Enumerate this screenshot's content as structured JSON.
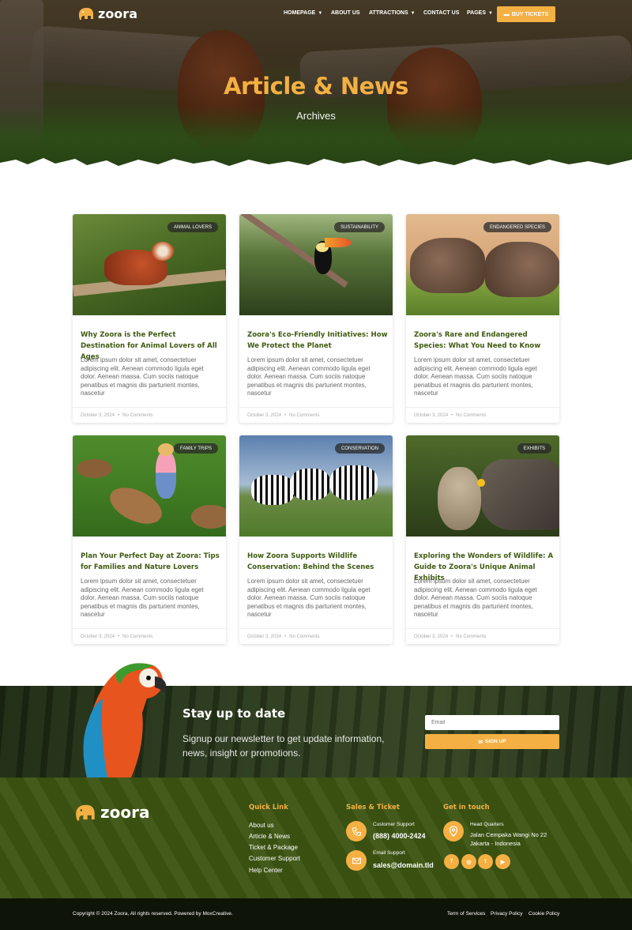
{
  "brand": {
    "name": "zoora"
  },
  "nav": {
    "items": [
      {
        "label": "HOMEPAGE",
        "has_dropdown": true
      },
      {
        "label": "ABOUT US",
        "has_dropdown": false
      },
      {
        "label": "ATTRACTIONS",
        "has_dropdown": true
      },
      {
        "label": "CONTACT US",
        "has_dropdown": false
      },
      {
        "label": "PAGES",
        "has_dropdown": true
      }
    ],
    "cta_label": "BUY TICKETS"
  },
  "hero": {
    "title": "Article & News",
    "subtitle": "Archives"
  },
  "posts": [
    {
      "category": "ANIMAL LOVERS",
      "title": "Why Zoora is the Perfect Destination for Animal Lovers of All Ages",
      "excerpt": "Lorem ipsum dolor sit amet, consectetuer adipiscing elit. Aenean commodo ligula eget dolor. Aenean massa. Cum sociis natoque penatibus et magnis dis parturient montes, nascetur",
      "date": "October 3, 2024",
      "comments": "No Comments"
    },
    {
      "category": "SUSTAINABILITY",
      "title": "Zoora's Eco-Friendly Initiatives: How We Protect the Planet",
      "excerpt": "Lorem ipsum dolor sit amet, consectetuer adipiscing elit. Aenean commodo ligula eget dolor. Aenean massa. Cum sociis natoque penatibus et magnis dis parturient montes, nascetur",
      "date": "October 3, 2024",
      "comments": "No Comments"
    },
    {
      "category": "ENDANGERED SPECIES",
      "title": "Zoora's Rare and Endangered Species: What You Need to Know",
      "excerpt": "Lorem ipsum dolor sit amet, consectetuer adipiscing elit. Aenean commodo ligula eget dolor. Aenean massa. Cum sociis natoque penatibus et magnis dis parturient montes, nascetur",
      "date": "October 3, 2024",
      "comments": "No Comments"
    },
    {
      "category": "FAMILY TRIPS",
      "title": "Plan Your Perfect Day at Zoora: Tips for Families and Nature Lovers",
      "excerpt": "Lorem ipsum dolor sit amet, consectetuer adipiscing elit. Aenean commodo ligula eget dolor. Aenean massa. Cum sociis natoque penatibus et magnis dis parturient montes, nascetur",
      "date": "October 3, 2024",
      "comments": "No Comments"
    },
    {
      "category": "CONSERVATION",
      "title": "How Zoora Supports Wildlife Conservation: Behind the Scenes",
      "excerpt": "Lorem ipsum dolor sit amet, consectetuer adipiscing elit. Aenean commodo ligula eget dolor. Aenean massa. Cum sociis natoque penatibus et magnis dis parturient montes, nascetur",
      "date": "October 3, 2024",
      "comments": "No Comments"
    },
    {
      "category": "EXHIBITS",
      "title": "Exploring the Wonders of Wildlife: A Guide to Zoora's Unique Animal Exhibits",
      "excerpt": "Lorem ipsum dolor sit amet, consectetuer adipiscing elit. Aenean commodo ligula eget dolor. Aenean massa. Cum sociis natoque penatibus et magnis dis parturient montes, nascetur",
      "date": "October 3, 2024",
      "comments": "No Comments"
    }
  ],
  "newsletter": {
    "title": "Stay up to date",
    "text": "Signup our newsletter to get update information, news, insight or promotions.",
    "email_placeholder": "Email",
    "button_label": "SIGN UP"
  },
  "footer": {
    "quick_link_title": "Quick Link",
    "quick_links": [
      "About us",
      "Article & News",
      "Ticket & Package",
      "Customer Support",
      "Help Center"
    ],
    "sales_title": "Sales & Ticket",
    "phone_label": "Customer Support",
    "phone": "(888) 4000-2424",
    "email_label": "Email Support",
    "email": "sales@domain.tld",
    "contact_title": "Get in touch",
    "hq_label": "Head Quarters",
    "hq_line1": "Jalan Cempaka Wangi No 22",
    "hq_line2": "Jakarta - Indonesia",
    "social_icons": [
      "facebook-icon",
      "instagram-icon",
      "twitter-icon",
      "youtube-icon"
    ],
    "copyright": "Copyright © 2024 Zoora, All rights reserved. Powered by MoxCreative.",
    "legal_links": [
      "Term of Services",
      "Privacy Policy",
      "Cookie Policy"
    ]
  },
  "colors": {
    "accent": "#f4b043",
    "title_green": "#3e5a10",
    "footer_green": "#3c5412",
    "bottom_bar": "#0f1409"
  }
}
